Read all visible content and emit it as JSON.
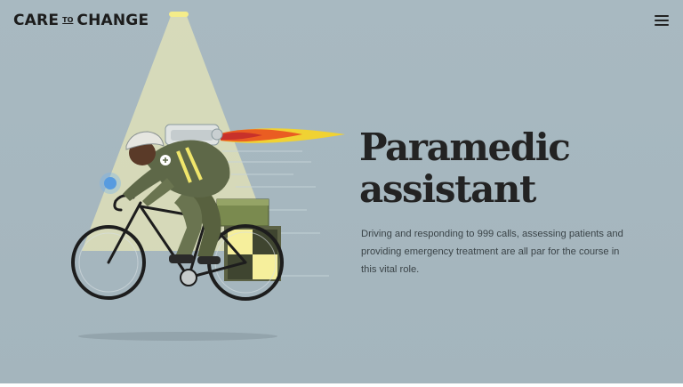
{
  "header": {
    "logo": {
      "word1": "CARE",
      "word2": "TO",
      "word3": "CHANGE"
    },
    "menu_icon": "hamburger-menu-icon"
  },
  "hero": {
    "title_line1": "Paramedic",
    "title_line2": "assistant",
    "description": "Driving and responding to 999 calls, assessing patients and providing emergency treatment are all par for the course in this vital role.",
    "illustration": "paramedic-on-jet-bicycle-illustration"
  },
  "colors": {
    "background": "#a9bac2",
    "text": "#232323",
    "body_text": "#3b4448",
    "light_beam": "#fdf6b4",
    "accent_yellow": "#f4ec8a"
  }
}
